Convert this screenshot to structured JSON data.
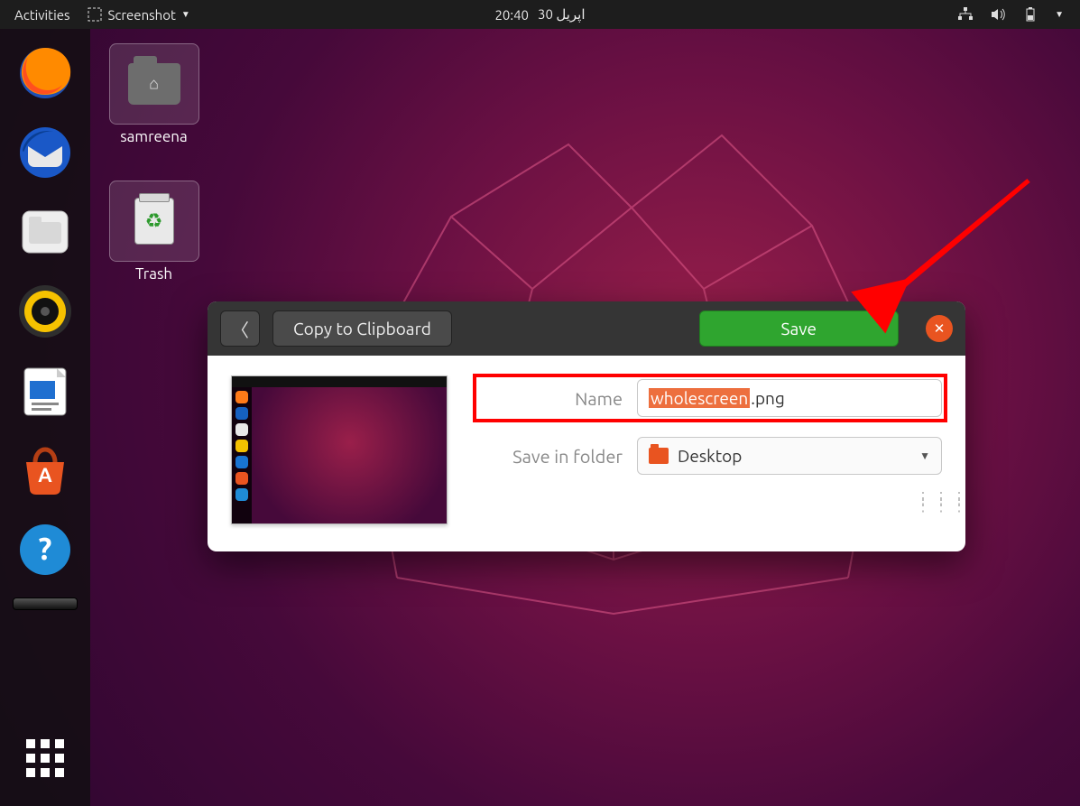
{
  "topbar": {
    "activities": "Activities",
    "app_name": "Screenshot",
    "clock": "20:40",
    "date": "اپریل 30"
  },
  "desktop": {
    "home_label": "samreena",
    "trash_label": "Trash"
  },
  "dialog": {
    "copy_label": "Copy to Clipboard",
    "save_label": "Save",
    "name_label": "Name",
    "name_value_selected": "wholescreen",
    "name_value_rest": ".png",
    "folder_label": "Save in folder",
    "folder_value": "Desktop"
  },
  "dock": {
    "apps": [
      "firefox",
      "thunderbird",
      "files",
      "rhythmbox",
      "libreoffice-writer",
      "ubuntu-software",
      "help"
    ]
  }
}
